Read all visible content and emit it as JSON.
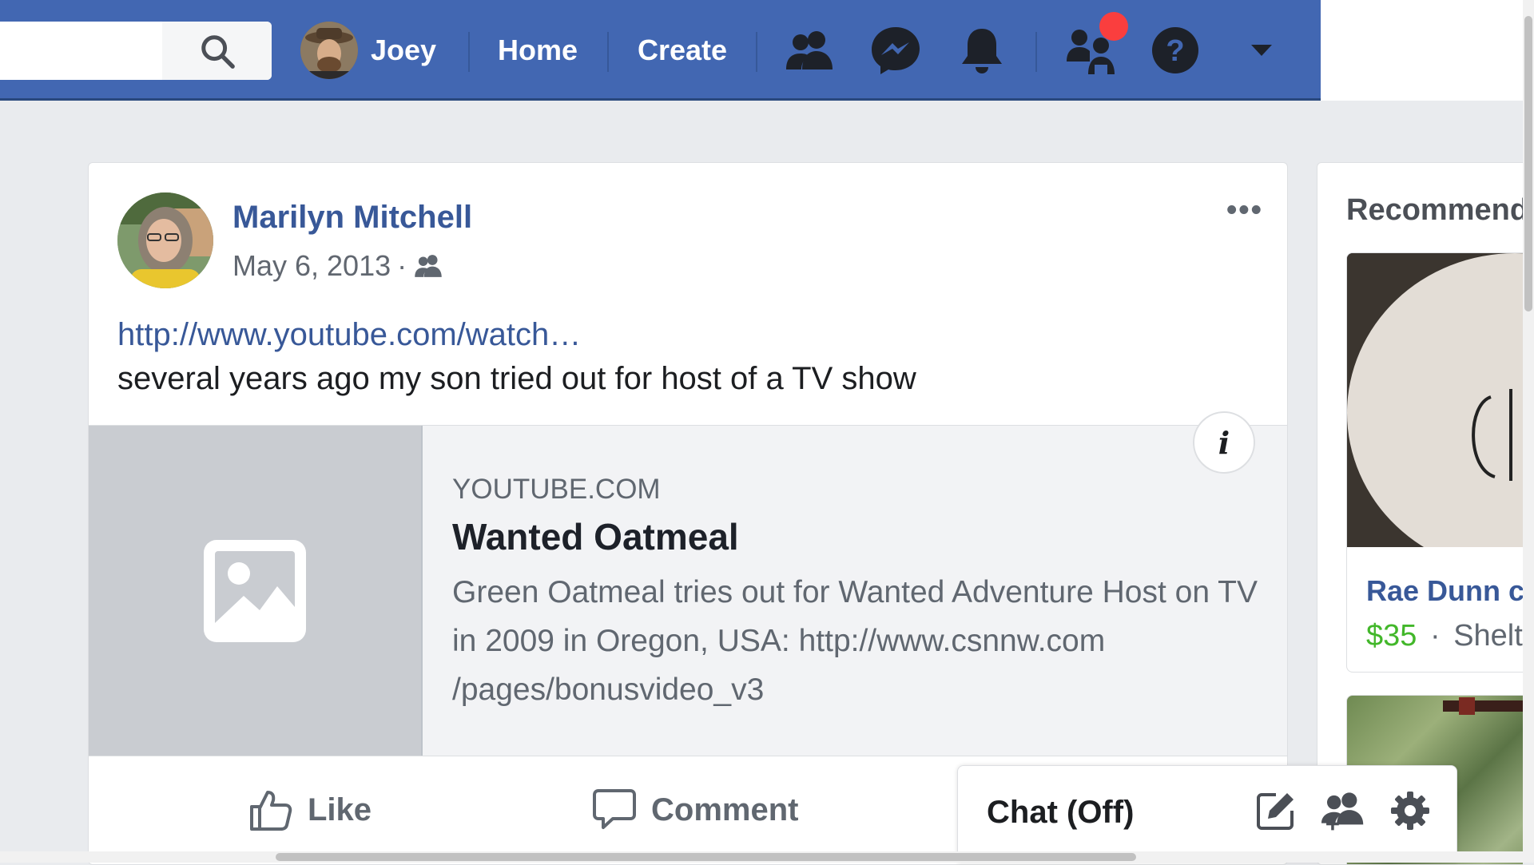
{
  "topbar": {
    "search": {
      "value": "",
      "placeholder": ""
    },
    "user_name": "Joey",
    "home_label": "Home",
    "create_label": "Create",
    "icons": [
      "friends-icon",
      "messenger-icon",
      "notifications-icon",
      "friend-requests-icon",
      "help-icon",
      "account-menu-icon"
    ],
    "colors": {
      "bar": "#4267b2",
      "notification": "#fa3e3e"
    }
  },
  "post": {
    "author": "Marilyn Mitchell",
    "date": "May 6, 2013",
    "separator": "·",
    "link_text": "http://www.youtube.com/watch…",
    "text": "several years ago my son tried out for host of a TV show",
    "more_label": "•••",
    "preview": {
      "domain": "YOUTUBE.COM",
      "title": "Wanted Oatmeal",
      "description": "Green Oatmeal tries out for Wanted Adventure Host on TV in 2009 in Oregon, USA: http://www.csnnw.com /pages/bonusvideo_v3",
      "info_label": "i"
    },
    "actions": {
      "like": "Like",
      "comment": "Comment"
    }
  },
  "chat": {
    "label": "Chat (Off)",
    "icons": [
      "new-message-icon",
      "create-group-icon",
      "chat-settings-icon"
    ]
  },
  "right_column": {
    "heading": "Recommend",
    "item1": {
      "title": "Rae Dunn c",
      "price": "$35",
      "separator": "·",
      "location": "Shelto"
    },
    "price_color": "#42b72a"
  }
}
